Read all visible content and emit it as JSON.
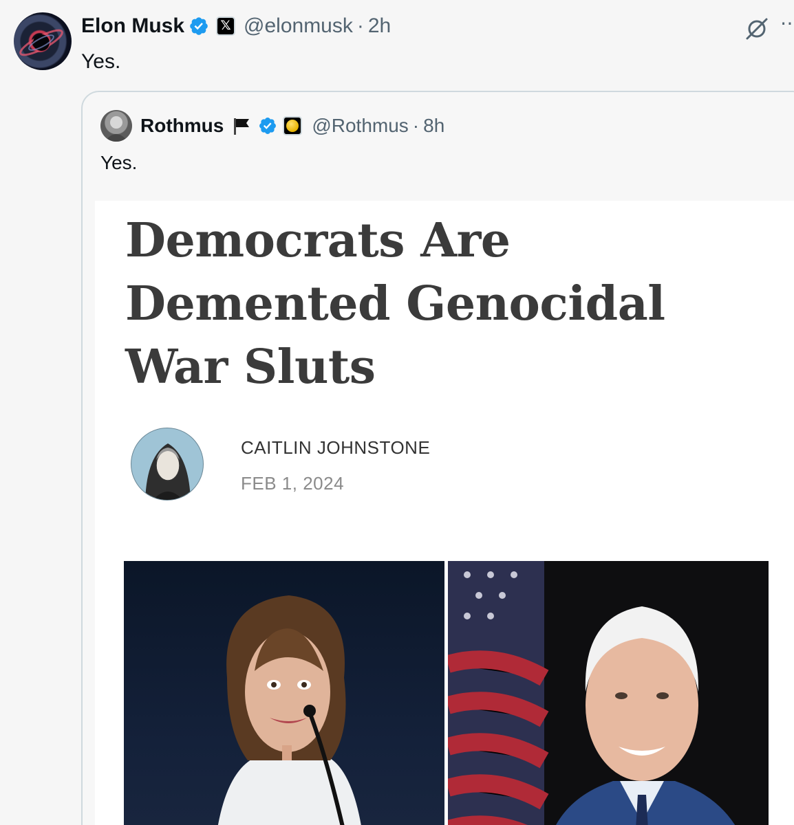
{
  "tweet": {
    "author": {
      "name": "Elon Musk",
      "handle": "@elonmusk",
      "separator": "·",
      "time": "2h",
      "affiliate_badge": "𝕏"
    },
    "text": "Yes.",
    "icons": [
      "grok-icon",
      "more-icon",
      "verified-badge-icon"
    ]
  },
  "quote": {
    "author": {
      "name": "Rothmus",
      "handle": "@Rothmus",
      "separator": "·",
      "time": "8h"
    },
    "text": "Yes.",
    "icons": [
      "flag-icon",
      "verified-badge-icon",
      "coin-icon"
    ],
    "article": {
      "headline_lines": [
        "Democrats Are",
        "Demented Genocidal",
        "War Sluts"
      ],
      "author": "CAITLIN JOHNSTONE",
      "date": "FEB 1, 2024"
    }
  },
  "colors": {
    "background": "#f6f6f6",
    "text_primary": "#0f1419",
    "text_secondary": "#536471",
    "verified_blue": "#1d9bf0",
    "border": "#cfd9de",
    "headline": "#3b3b3b"
  }
}
